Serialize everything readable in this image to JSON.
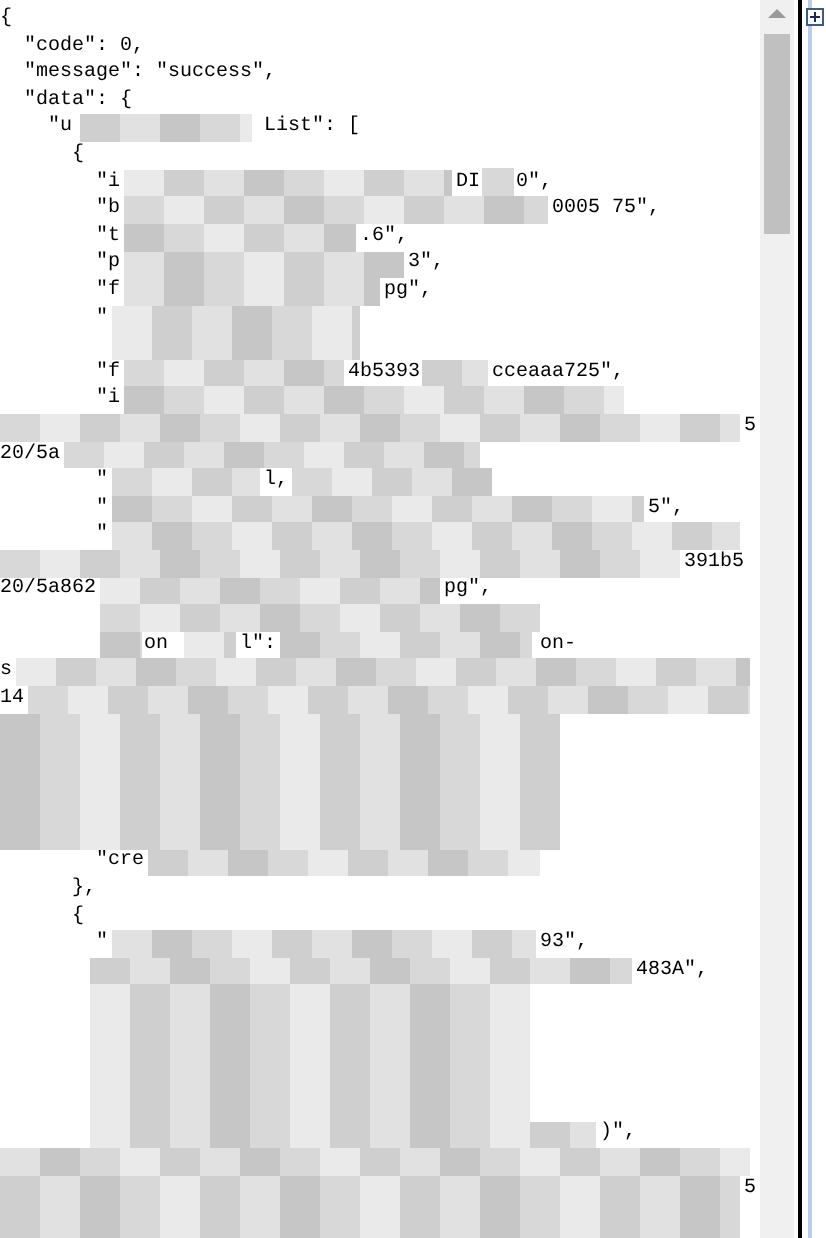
{
  "json_view": {
    "lines": [
      {
        "kind": "code",
        "fragments": [
          "{"
        ]
      },
      {
        "kind": "code",
        "fragments": [
          "  \"code\": 0,"
        ]
      },
      {
        "kind": "code",
        "fragments": [
          "  \"message\": \"success\","
        ]
      },
      {
        "kind": "code",
        "fragments": [
          "  \"data\": {"
        ]
      },
      {
        "kind": "code",
        "fragments": [
          "    \"u",
          "                List\": ["
        ]
      },
      {
        "kind": "code",
        "fragments": [
          "      {"
        ]
      },
      {
        "kind": "code",
        "fragments": [
          "        \"i",
          "                            DI",
          "   0\","
        ]
      },
      {
        "kind": "code",
        "fragments": [
          "        \"b",
          "                                    0005",
          " 75\","
        ]
      },
      {
        "kind": "code",
        "fragments": [
          "        \"t",
          "                    .6\","
        ]
      },
      {
        "kind": "code",
        "fragments": [
          "        \"p",
          "                        3\","
        ]
      },
      {
        "kind": "code",
        "fragments": [
          "        \"f",
          "                      pg\","
        ]
      },
      {
        "kind": "code",
        "fragments": [
          "        \""
        ]
      },
      {
        "kind": "masked"
      },
      {
        "kind": "code",
        "fragments": [
          "        \"f",
          "                   4b5393",
          "      cceaaa725\","
        ]
      },
      {
        "kind": "code",
        "fragments": [
          "        \"i"
        ]
      },
      {
        "kind": "code",
        "fragments": [
          "                                                              5"
        ]
      },
      {
        "kind": "code",
        "fragments": [
          "20/5a"
        ]
      },
      {
        "kind": "code",
        "fragments": [
          "        \"",
          "             l,"
        ]
      },
      {
        "kind": "code",
        "fragments": [
          "        \"",
          "                                             5\","
        ]
      },
      {
        "kind": "code",
        "fragments": [
          "        \""
        ]
      },
      {
        "kind": "code",
        "fragments": [
          "                                                         391b5"
        ]
      },
      {
        "kind": "code",
        "fragments": [
          "20/5a862",
          "                             pg\","
        ]
      },
      {
        "kind": "masked"
      },
      {
        "kind": "code",
        "fragments": [
          "            on",
          "      l\":",
          "                      on-"
        ]
      },
      {
        "kind": "code",
        "fragments": [
          "s"
        ]
      },
      {
        "kind": "code",
        "fragments": [
          "14"
        ]
      },
      {
        "kind": "masked"
      },
      {
        "kind": "masked"
      },
      {
        "kind": "masked"
      },
      {
        "kind": "masked"
      },
      {
        "kind": "masked"
      },
      {
        "kind": "code",
        "fragments": [
          "        \"cre"
        ]
      },
      {
        "kind": "code",
        "fragments": [
          "      },"
        ]
      },
      {
        "kind": "code",
        "fragments": [
          "      {"
        ]
      },
      {
        "kind": "code",
        "fragments": [
          "        \"",
          "                                    93\","
        ]
      },
      {
        "kind": "code",
        "fragments": [
          "                                                     483A\","
        ]
      },
      {
        "kind": "masked"
      },
      {
        "kind": "masked"
      },
      {
        "kind": "masked"
      },
      {
        "kind": "masked"
      },
      {
        "kind": "masked"
      },
      {
        "kind": "code",
        "fragments": [
          "                                                  )\","
        ]
      },
      {
        "kind": "masked"
      },
      {
        "kind": "code",
        "fragments": [
          "                                                              5"
        ]
      },
      {
        "kind": "masked"
      }
    ]
  }
}
